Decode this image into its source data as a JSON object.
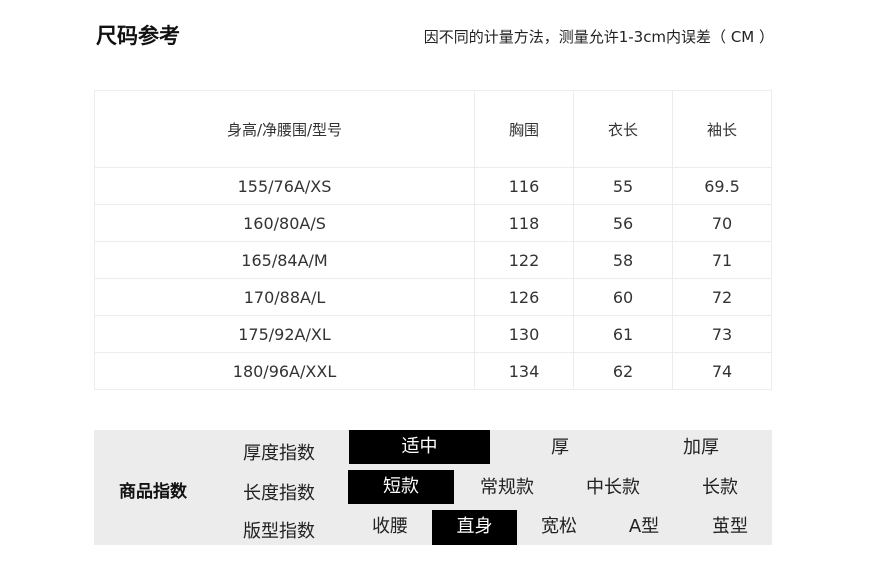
{
  "header": {
    "title": "尺码参考",
    "note": "因不同的计量方法，测量允许1-3cm内误差（ CM ）"
  },
  "size_table": {
    "columns": [
      "身高/净腰围/型号",
      "胸围",
      "衣长",
      "袖长"
    ],
    "rows": [
      [
        "155/76A/XS",
        "116",
        "55",
        "69.5"
      ],
      [
        "160/80A/S",
        "118",
        "56",
        "70"
      ],
      [
        "165/84A/M",
        "122",
        "58",
        "71"
      ],
      [
        "170/88A/L",
        "126",
        "60",
        "72"
      ],
      [
        "175/92A/XL",
        "130",
        "61",
        "73"
      ],
      [
        "180/96A/XXL",
        "134",
        "62",
        "74"
      ]
    ]
  },
  "product_index": {
    "label": "商品指数",
    "rows": [
      {
        "name": "厚度指数",
        "options": [
          "适中",
          "厚",
          "加厚"
        ],
        "selected": "适中"
      },
      {
        "name": "长度指数",
        "options": [
          "短款",
          "常规款",
          "中长款",
          "长款"
        ],
        "selected": "短款"
      },
      {
        "name": "版型指数",
        "options": [
          "收腰",
          "直身",
          "宽松",
          "A型",
          "茧型"
        ],
        "selected": "直身"
      }
    ]
  },
  "colors": {
    "selected_bg": "#000000",
    "panel_bg": "#ececec"
  }
}
